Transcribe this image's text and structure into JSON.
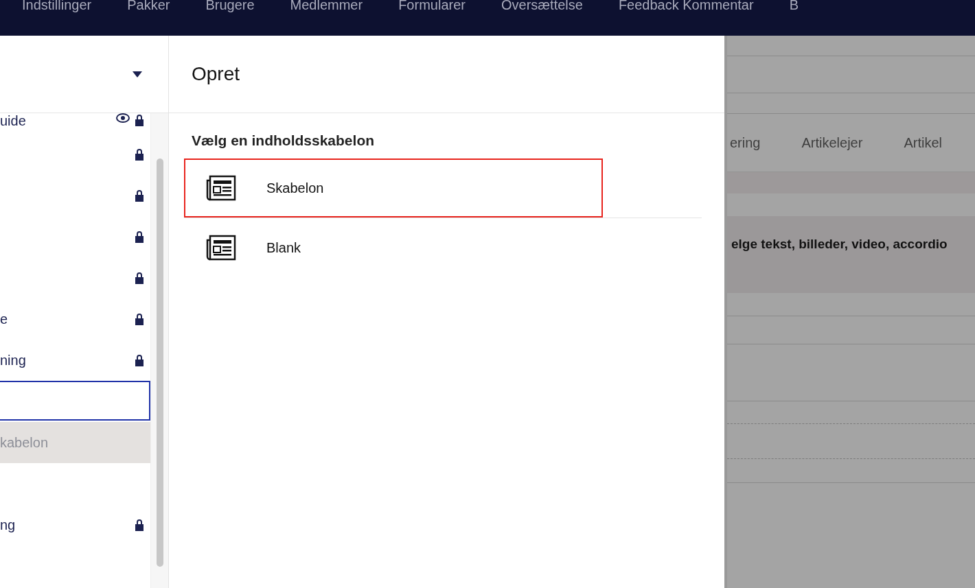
{
  "top_nav": {
    "items": [
      {
        "label": "Indstillinger"
      },
      {
        "label": "Pakker"
      },
      {
        "label": "Brugere"
      },
      {
        "label": "Medlemmer"
      },
      {
        "label": "Formularer"
      },
      {
        "label": "Oversættelse"
      },
      {
        "label": "Feedback Kommentar"
      },
      {
        "label": "B"
      }
    ]
  },
  "tree": {
    "items": [
      {
        "label": "uide",
        "locked": true,
        "eye": true,
        "selected": false,
        "highlighted": false
      },
      {
        "locked": true,
        "eye": false,
        "selected": false,
        "highlighted": false
      },
      {
        "locked": true,
        "eye": false,
        "selected": false,
        "highlighted": false
      },
      {
        "locked": true,
        "eye": false,
        "selected": false,
        "highlighted": false
      },
      {
        "locked": true,
        "eye": false,
        "selected": false,
        "highlighted": false
      },
      {
        "label": "e",
        "locked": true,
        "eye": false,
        "selected": false,
        "highlighted": false
      },
      {
        "label": "ning",
        "locked": true,
        "eye": false,
        "selected": false,
        "highlighted": false
      },
      {
        "locked": false,
        "eye": false,
        "selected": true,
        "highlighted": false
      },
      {
        "label": "kabelon",
        "locked": false,
        "eye": false,
        "selected": false,
        "highlighted": true
      },
      {
        "label": "ng",
        "locked": true,
        "eye": false,
        "selected": false,
        "highlighted": false
      }
    ]
  },
  "dialog": {
    "title": "Opret",
    "subtitle": "Vælg en indholdsskabelon",
    "options": [
      {
        "label": "Skabelon",
        "selected": true
      },
      {
        "label": "Blank",
        "selected": false
      }
    ]
  },
  "background": {
    "tabs": [
      {
        "label": "ering"
      },
      {
        "label": "Artikelejer"
      },
      {
        "label": "Artikel"
      }
    ],
    "description": "elge tekst, billeder, video, accordio"
  }
}
